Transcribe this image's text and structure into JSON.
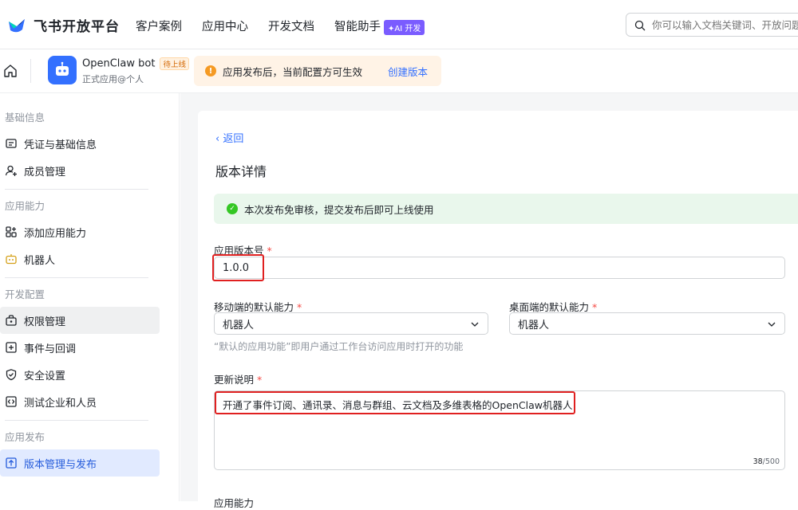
{
  "brand": {
    "name": "飞书开放平台"
  },
  "nav": {
    "items": [
      "客户案例",
      "应用中心",
      "开发文档",
      "智能助手"
    ],
    "ai_badge": "✦AI 开发"
  },
  "search": {
    "placeholder": "你可以输入文档关键词、开放问题"
  },
  "app": {
    "name": "OpenClaw bot",
    "status": "待上线",
    "subtitle": "正式应用@个人"
  },
  "notice": {
    "text": "应用发布后，当前配置方可生效",
    "link": "创建版本"
  },
  "sidebar": {
    "groups": [
      {
        "title": "基础信息",
        "items": [
          "凭证与基础信息",
          "成员管理"
        ]
      },
      {
        "title": "应用能力",
        "items": [
          "添加应用能力",
          "机器人"
        ]
      },
      {
        "title": "开发配置",
        "items": [
          "权限管理",
          "事件与回调",
          "安全设置",
          "测试企业和人员"
        ]
      },
      {
        "title": "应用发布",
        "items": [
          "版本管理与发布"
        ]
      }
    ]
  },
  "page": {
    "back": "返回",
    "title": "版本详情",
    "success": "本次发布免审核，提交发布后即可上线使用",
    "version_label": "应用版本号",
    "version_value": "1.0.0",
    "mobile_label": "移动端的默认能力",
    "mobile_value": "机器人",
    "desktop_label": "桌面端的默认能力",
    "desktop_value": "机器人",
    "hint": "“默认的应用功能”即用户通过工作台访问应用时打开的功能",
    "notes_label": "更新说明",
    "notes_value": "开通了事件订阅、通讯录、消息与群组、云文档及多维表格的OpenClaw机器人",
    "counter_current": "38",
    "counter_max": "/500",
    "next_label": "应用能力",
    "required_mark": "*"
  },
  "colors": {
    "accent": "#3370ff",
    "highlight": "#e02020",
    "success_bg": "#e9f7ec",
    "notice_bg": "#fff3e6"
  }
}
